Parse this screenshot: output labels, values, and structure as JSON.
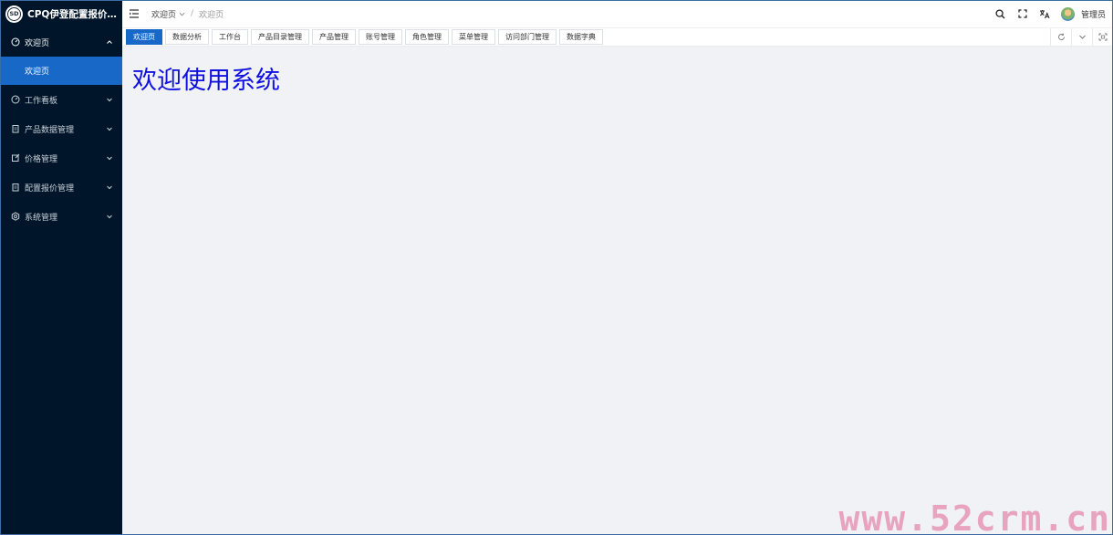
{
  "app": {
    "title": "CPQ伊登配置报价系..."
  },
  "sidebar": {
    "items": [
      {
        "label": "欢迎页",
        "icon": "dashboard-icon",
        "open": true
      },
      {
        "label": "工作看板",
        "icon": "dashboard-icon"
      },
      {
        "label": "产品数据管理",
        "icon": "clipboard-icon"
      },
      {
        "label": "价格管理",
        "icon": "edit-icon"
      },
      {
        "label": "配置报价管理",
        "icon": "clipboard-icon"
      },
      {
        "label": "系统管理",
        "icon": "gear-icon"
      }
    ],
    "submenu": {
      "label": "欢迎页"
    }
  },
  "header": {
    "breadcrumb": {
      "first": "欢迎页",
      "separator": "/",
      "current": "欢迎页"
    },
    "user_name": "管理员"
  },
  "tabs": [
    {
      "label": "欢迎页",
      "active": true
    },
    {
      "label": "数据分析"
    },
    {
      "label": "工作台"
    },
    {
      "label": "产品目录管理"
    },
    {
      "label": "产品管理"
    },
    {
      "label": "账号管理"
    },
    {
      "label": "角色管理"
    },
    {
      "label": "菜单管理"
    },
    {
      "label": "访问部门管理"
    },
    {
      "label": "数据字典"
    }
  ],
  "main": {
    "welcome_text": "欢迎使用系统"
  },
  "watermark": "www.52crm.cn",
  "colors": {
    "sidebar_bg": "#001529",
    "accent": "#1868c8",
    "welcome_text": "#1010e0",
    "content_bg": "#f0f2f5"
  }
}
